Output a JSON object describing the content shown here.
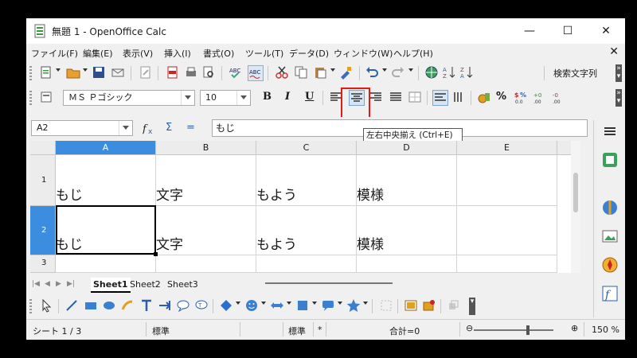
{
  "window": {
    "title": "無題 1 - OpenOffice Calc",
    "minimize": "—",
    "maximize": "☐",
    "close": "✕"
  },
  "menu": {
    "items": [
      "ファイル(F)",
      "編集(E)",
      "表示(V)",
      "挿入(I)",
      "書式(O)",
      "ツール(T)",
      "データ(D)",
      "ウィンドウ(W)",
      "ヘルプ(H)"
    ],
    "close": "✕"
  },
  "toolbar1": {
    "search_label": "検索文字列"
  },
  "toolbar2": {
    "font_name": "ＭＳ Ｐゴシック",
    "font_size": "10",
    "bold": "B",
    "italic": "I",
    "underline": "U",
    "percent": "%"
  },
  "tooltip": {
    "text": "左右中央揃え (Ctrl+E)"
  },
  "formula_bar": {
    "cell_ref": "A2",
    "sum": "Σ",
    "equals": "=",
    "content": "もじ"
  },
  "sheet": {
    "columns": [
      "A",
      "B",
      "C",
      "D",
      "E"
    ],
    "rows": [
      {
        "num": "1",
        "cells": [
          "もじ",
          "文字",
          "もよう",
          "模様",
          ""
        ]
      },
      {
        "num": "2",
        "cells": [
          "もじ",
          "文字",
          "もよう",
          "模様",
          ""
        ]
      },
      {
        "num": "3",
        "cells": [
          "",
          "",
          "",
          "",
          ""
        ]
      }
    ],
    "selected_cell": "A2"
  },
  "tabs": [
    "Sheet1",
    "Sheet2",
    "Sheet3"
  ],
  "status": {
    "sheet": "シート 1 / 3",
    "style": "標準",
    "mode": "標準",
    "modified": "*",
    "sum": "合計=0",
    "zoom": "150 %"
  },
  "colors": {
    "selection": "#3c8de0",
    "highlight_box": "#e01b1b"
  },
  "icons": {
    "sidebar": [
      "properties-icon",
      "styles-icon",
      "gallery-icon",
      "navigator-icon",
      "functions-icon"
    ]
  }
}
